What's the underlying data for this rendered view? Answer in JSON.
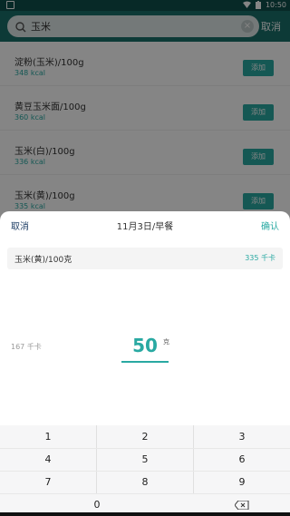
{
  "status_bar": {
    "time": "10:50"
  },
  "search": {
    "value": "玉米",
    "cancel_label": "取消"
  },
  "foods": [
    {
      "name": "淀粉(玉米)/100g",
      "kcal": "348 kcal",
      "add_label": "添加"
    },
    {
      "name": "黄豆玉米面/100g",
      "kcal": "360 kcal",
      "add_label": "添加"
    },
    {
      "name": "玉米(白)/100g",
      "kcal": "336 kcal",
      "add_label": "添加"
    },
    {
      "name": "玉米(黄)/100g",
      "kcal": "335 kcal",
      "add_label": "添加"
    }
  ],
  "sheet": {
    "cancel_label": "取消",
    "title": "11月3日/早餐",
    "confirm_label": "确认",
    "item_name": "玉米(黄)/100克",
    "item_kcal": "335 千卡",
    "calories": "167 千卡",
    "amount": "50",
    "unit": "克"
  },
  "keypad": {
    "k1": "1",
    "k2": "2",
    "k3": "3",
    "k4": "4",
    "k5": "5",
    "k6": "6",
    "k7": "7",
    "k8": "8",
    "k9": "9",
    "k0": "0"
  },
  "colors": {
    "header": "#1a6f6a",
    "accent": "#29a9a2"
  }
}
